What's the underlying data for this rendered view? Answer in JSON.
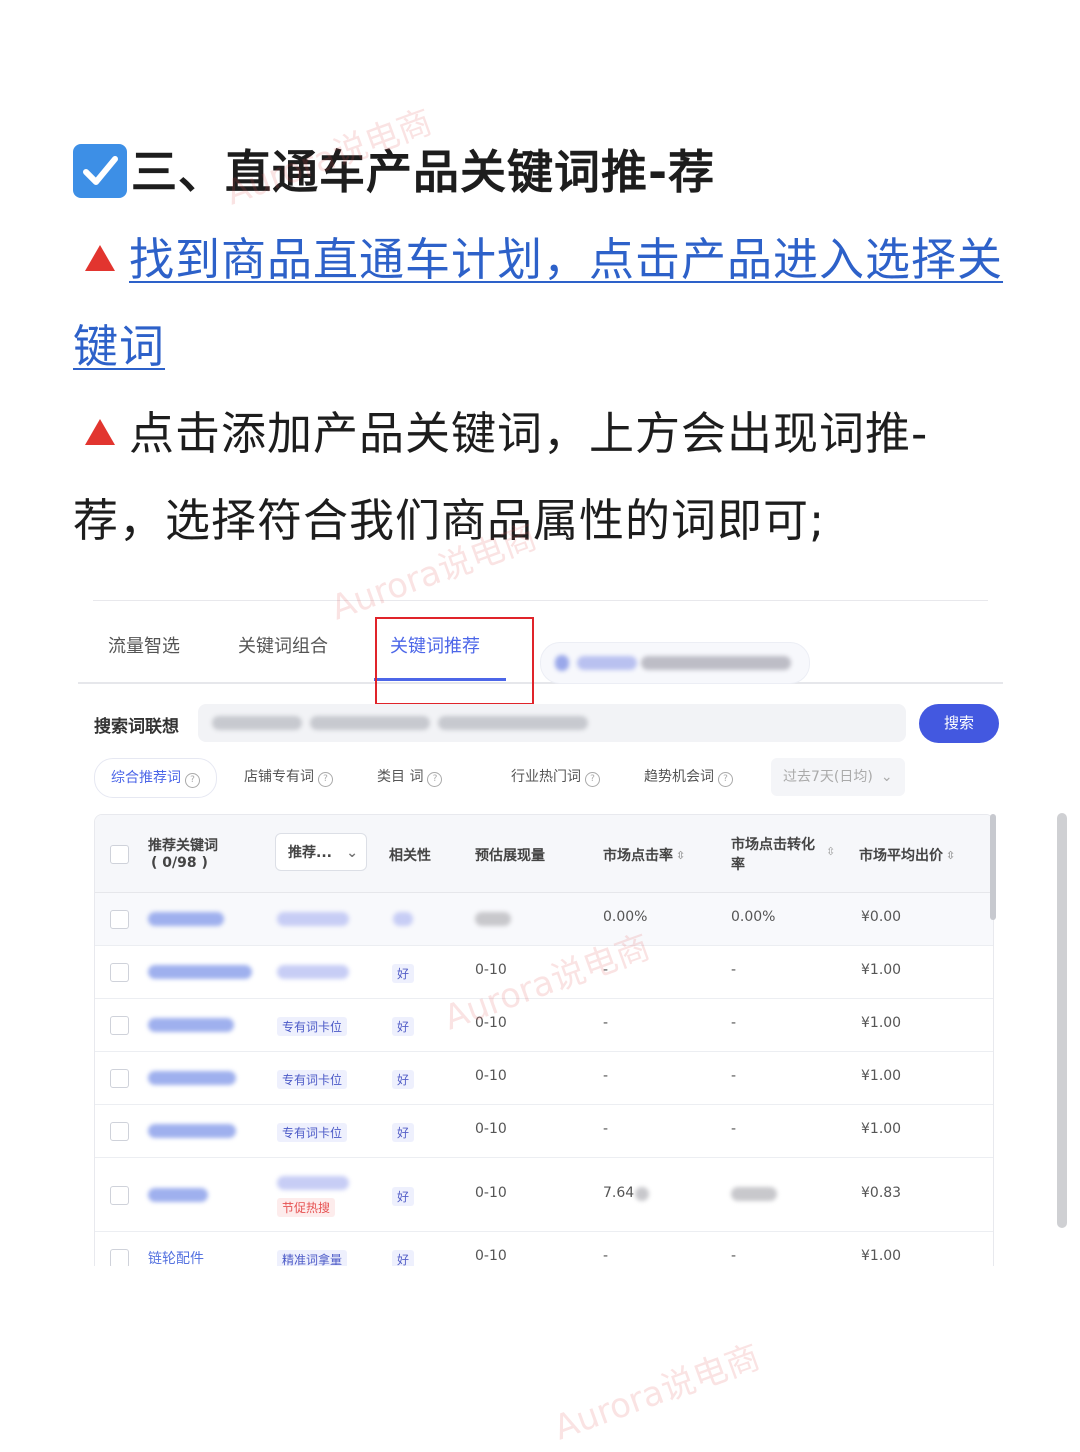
{
  "article": {
    "heading": "三、直通车产品关键词推-荐",
    "step1_link": "找到商品直通车计划，点击产品进入选择关键词",
    "step2_text": "点击添加产品关键词，上方会出现词推-荐，选择符合我们商品属性的词即可;"
  },
  "screenshot": {
    "tabs": [
      {
        "label": "流量智选"
      },
      {
        "label": "关键词组合"
      },
      {
        "label": "关键词推荐",
        "active": true
      }
    ],
    "search": {
      "label": "搜索词联想",
      "button": "搜索"
    },
    "chips": [
      {
        "label": "综合推荐词",
        "active": true
      },
      {
        "label": "店铺专有词"
      },
      {
        "label": "类目 词"
      },
      {
        "label": "行业热门词"
      },
      {
        "label": "趋势机会词"
      }
    ],
    "date_filter": "过去7天(日均)",
    "table": {
      "headers": {
        "keyword": "推荐关键词",
        "keyword_count": "( 0/98 )",
        "recommend_select": "推荐...",
        "relevance": "相关性",
        "impressions": "预估展现量",
        "ctr": "市场点击率",
        "cvr": "市场点击转化率",
        "avg_bid": "市场平均出价"
      },
      "rows": [
        {
          "tag": "",
          "relevance": "",
          "impressions": "",
          "ctr": "0.00%",
          "cvr": "0.00%",
          "bid": "¥0.00"
        },
        {
          "tag": "",
          "relevance": "好",
          "impressions": "0-10",
          "ctr": "-",
          "cvr": "-",
          "bid": "¥1.00"
        },
        {
          "tag": "专有词卡位",
          "relevance": "好",
          "impressions": "0-10",
          "ctr": "-",
          "cvr": "-",
          "bid": "¥1.00"
        },
        {
          "tag": "专有词卡位",
          "relevance": "好",
          "impressions": "0-10",
          "ctr": "-",
          "cvr": "-",
          "bid": "¥1.00"
        },
        {
          "tag": "专有词卡位",
          "relevance": "好",
          "impressions": "0-10",
          "ctr": "-",
          "cvr": "-",
          "bid": "¥1.00"
        },
        {
          "tag": "",
          "tag2": "节促热搜",
          "relevance": "好",
          "impressions": "0-10",
          "ctr": "7.64",
          "cvr": "",
          "bid": "¥0.83"
        },
        {
          "keyword": "链轮配件",
          "tag": "精准词拿量",
          "relevance": "好",
          "impressions": "0-10",
          "ctr": "-",
          "cvr": "-",
          "bid": "¥1.00"
        }
      ]
    }
  },
  "watermark": "Aurora说电商"
}
